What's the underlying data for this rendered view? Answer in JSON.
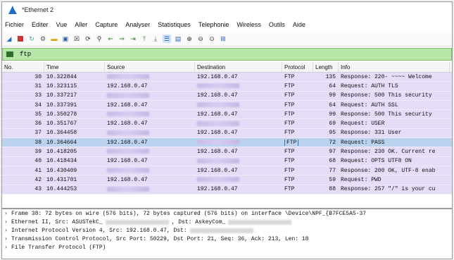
{
  "window": {
    "title": "*Ethernet 2"
  },
  "menu": [
    "Fichier",
    "Editer",
    "Vue",
    "Aller",
    "Capture",
    "Analyser",
    "Statistiques",
    "Telephonie",
    "Wireless",
    "Outils",
    "Aide"
  ],
  "toolbar": [
    "shark-fin-icon",
    "stop-icon",
    "restart-icon",
    "options-icon",
    "open-icon",
    "save-icon",
    "close-file-icon",
    "reload-icon",
    "find-icon",
    "back-icon",
    "forward-icon",
    "goto-icon",
    "first-icon",
    "last-icon",
    "autoscroll-icon",
    "colorize-icon",
    "zoom-in-icon",
    "zoom-out-icon",
    "zoom-normal-icon",
    "resize-columns-icon"
  ],
  "filter": {
    "value": "ftp"
  },
  "columns": {
    "no": "No.",
    "time": "Time",
    "source": "Source",
    "destination": "Destination",
    "protocol": "Protocol",
    "length": "Length",
    "info": "Info"
  },
  "packets": [
    {
      "no": "30",
      "time": "10.322844",
      "src": "",
      "dst": "192.168.0.47",
      "proto": "FTP",
      "len": "135",
      "info": "Response: 220-  ~~~~ Welcome"
    },
    {
      "no": "31",
      "time": "10.323115",
      "src": "192.168.0.47",
      "dst": "",
      "proto": "FTP",
      "len": "64",
      "info": "Request: AUTH TLS"
    },
    {
      "no": "33",
      "time": "10.337217",
      "src": "",
      "dst": "192.168.0.47",
      "proto": "FTP",
      "len": "99",
      "info": "Response: 500 This security"
    },
    {
      "no": "34",
      "time": "10.337391",
      "src": "192.168.0.47",
      "dst": "",
      "proto": "FTP",
      "len": "64",
      "info": "Request: AUTH SSL"
    },
    {
      "no": "35",
      "time": "10.350278",
      "src": "",
      "dst": "192.168.0.47",
      "proto": "FTP",
      "len": "99",
      "info": "Response: 500 This security"
    },
    {
      "no": "36",
      "time": "10.351767",
      "src": "192.168.0.47",
      "dst": "",
      "proto": "FTP",
      "len": "69",
      "info": "Request: USER"
    },
    {
      "no": "37",
      "time": "10.364458",
      "src": "",
      "dst": "192.168.0.47",
      "proto": "FTP",
      "len": "95",
      "info": "Response: 331 User"
    },
    {
      "no": "38",
      "time": "10.364664",
      "src": "192.168.0.47",
      "dst": "",
      "proto": "FTP",
      "len": "72",
      "info": "Request: PASS"
    },
    {
      "no": "39",
      "time": "10.418205",
      "src": "",
      "dst": "192.168.0.47",
      "proto": "FTP",
      "len": "97",
      "info": "Response: 230 OK. Current re"
    },
    {
      "no": "40",
      "time": "10.418434",
      "src": "192.168.0.47",
      "dst": "",
      "proto": "FTP",
      "len": "68",
      "info": "Request: OPTS UTF8 ON"
    },
    {
      "no": "41",
      "time": "10.430409",
      "src": "",
      "dst": "192.168.0.47",
      "proto": "FTP",
      "len": "77",
      "info": "Response: 200 OK, UTF-8 enab"
    },
    {
      "no": "42",
      "time": "10.431701",
      "src": "192.168.0.47",
      "dst": "",
      "proto": "FTP",
      "len": "59",
      "info": "Request: PWD"
    },
    {
      "no": "43",
      "time": "10.444253",
      "src": "",
      "dst": "192.168.0.47",
      "proto": "FTP",
      "len": "88",
      "info": "Response: 257 \"/\" is your cu"
    }
  ],
  "selected_row_index": 7,
  "details": [
    {
      "text": "Frame 38: 72 bytes on wire (576 bits), 72 bytes captured (576 bits) on interface \\Device\\NPF_{B7FCE5A5-37"
    },
    {
      "text": "Ethernet II, Src: ASUSTekC_",
      "suffix": ", Dst: AskeyCom_"
    },
    {
      "text": "Internet Protocol Version 4, Src: 192.168.0.47, Dst:"
    },
    {
      "text": "Transmission Control Protocol, Src Port: 50229, Dst Port: 21, Seq: 36, Ack: 213, Len: 18"
    },
    {
      "text": "File Transfer Protocol (FTP)"
    }
  ],
  "colors": {
    "row": "#e5dcf7",
    "selected_row": "#bcd3ef",
    "filter_bg": "#b6e6a8"
  }
}
